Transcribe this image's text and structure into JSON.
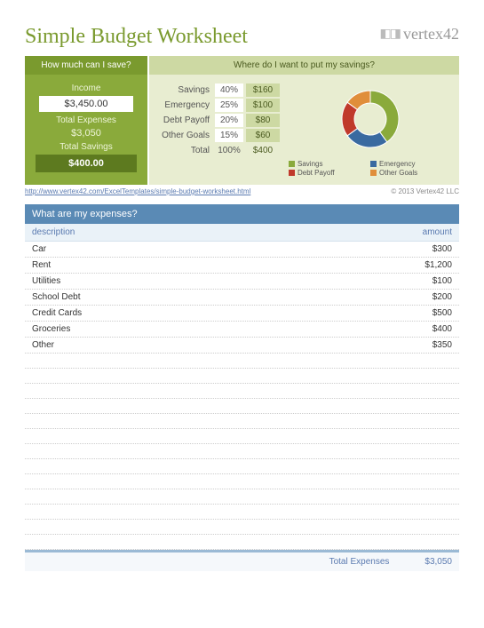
{
  "title": "Simple Budget Worksheet",
  "logo_text": "vertex42",
  "left": {
    "header": "How much can I save?",
    "income_label": "Income",
    "income_value": "$3,450.00",
    "expenses_label": "Total Expenses",
    "expenses_value": "$3,050",
    "savings_label": "Total Savings",
    "savings_value": "$400.00"
  },
  "right": {
    "header": "Where do I want to put my savings?",
    "rows": [
      {
        "label": "Savings",
        "pct": "40%",
        "amt": "$160"
      },
      {
        "label": "Emergency",
        "pct": "25%",
        "amt": "$100"
      },
      {
        "label": "Debt Payoff",
        "pct": "20%",
        "amt": "$80"
      },
      {
        "label": "Other Goals",
        "pct": "15%",
        "amt": "$60"
      }
    ],
    "total_label": "Total",
    "total_pct": "100%",
    "total_amt": "$400"
  },
  "chart_data": {
    "type": "pie",
    "title": "",
    "series": [
      {
        "name": "Savings",
        "value": 40,
        "color": "#8aaa3b"
      },
      {
        "name": "Emergency",
        "value": 25,
        "color": "#3a6aa0"
      },
      {
        "name": "Debt Payoff",
        "value": 20,
        "color": "#c0392b"
      },
      {
        "name": "Other Goals",
        "value": 15,
        "color": "#e08e3a"
      }
    ]
  },
  "link_text": "http://www.vertex42.com/ExcelTemplates/simple-budget-worksheet.html",
  "copyright": "© 2013 Vertex42 LLC",
  "expenses": {
    "header": "What are my expenses?",
    "col_desc": "description",
    "col_amt": "amount",
    "rows": [
      {
        "desc": "Car",
        "amt": "$300"
      },
      {
        "desc": "Rent",
        "amt": "$1,200"
      },
      {
        "desc": "Utilities",
        "amt": "$100"
      },
      {
        "desc": "School Debt",
        "amt": "$200"
      },
      {
        "desc": "Credit Cards",
        "amt": "$500"
      },
      {
        "desc": "Groceries",
        "amt": "$400"
      },
      {
        "desc": "Other",
        "amt": "$350"
      }
    ],
    "blank_count": 13,
    "total_label": "Total Expenses",
    "total_value": "$3,050"
  }
}
